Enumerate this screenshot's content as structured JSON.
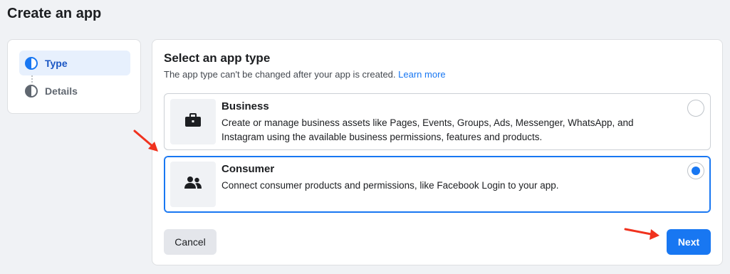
{
  "page": {
    "title": "Create an app"
  },
  "stepper": {
    "steps": [
      {
        "label": "Type",
        "state": "active",
        "icon": "half-circle-icon"
      },
      {
        "label": "Details",
        "state": "inactive",
        "icon": "half-circle-icon"
      }
    ]
  },
  "panel": {
    "title": "Select an app type",
    "subtitle": "The app type can't be changed after your app is created.",
    "learn_more": "Learn more",
    "options": [
      {
        "title": "Business",
        "description": "Create or manage business assets like Pages, Events, Groups, Ads, Messenger, WhatsApp, and Instagram using the available business permissions, features and products.",
        "icon": "briefcase-icon",
        "selected": false
      },
      {
        "title": "Consumer",
        "description": "Connect consumer products and permissions, like Facebook Login to your app.",
        "icon": "people-icon",
        "selected": true
      }
    ],
    "cancel_label": "Cancel",
    "next_label": "Next"
  },
  "colors": {
    "accent": "#1877f2",
    "annotation_arrow": "#f0321e"
  }
}
